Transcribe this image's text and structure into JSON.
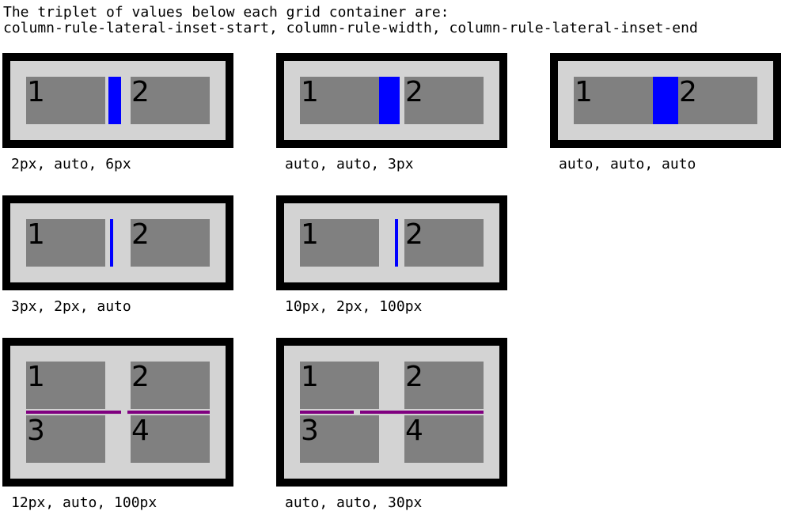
{
  "intro": {
    "line1": "The triplet of values below each grid container are:",
    "line2": "column-rule-lateral-inset-start, column-rule-width, column-rule-lateral-inset-end"
  },
  "rule_colors": {
    "column_rule": "#0000ff",
    "row_rule": "#800080",
    "item": "#808080",
    "container": "#d3d3d3",
    "border": "#000000"
  },
  "examples": [
    {
      "caption": "2px, auto, 6px",
      "items": [
        "1",
        "2"
      ]
    },
    {
      "caption": "auto, auto, 3px",
      "items": [
        "1",
        "2"
      ]
    },
    {
      "caption": "auto, auto, auto",
      "items": [
        "1",
        "2"
      ]
    },
    {
      "caption": "3px, 2px, auto",
      "items": [
        "1",
        "2"
      ]
    },
    {
      "caption": "10px, 2px, 100px",
      "items": [
        "1",
        "2"
      ]
    },
    {
      "caption": "12px, auto, 100px",
      "items": [
        "1",
        "2",
        "3",
        "4"
      ]
    },
    {
      "caption": "auto, auto, 30px",
      "items": [
        "1",
        "2",
        "3",
        "4"
      ]
    }
  ]
}
